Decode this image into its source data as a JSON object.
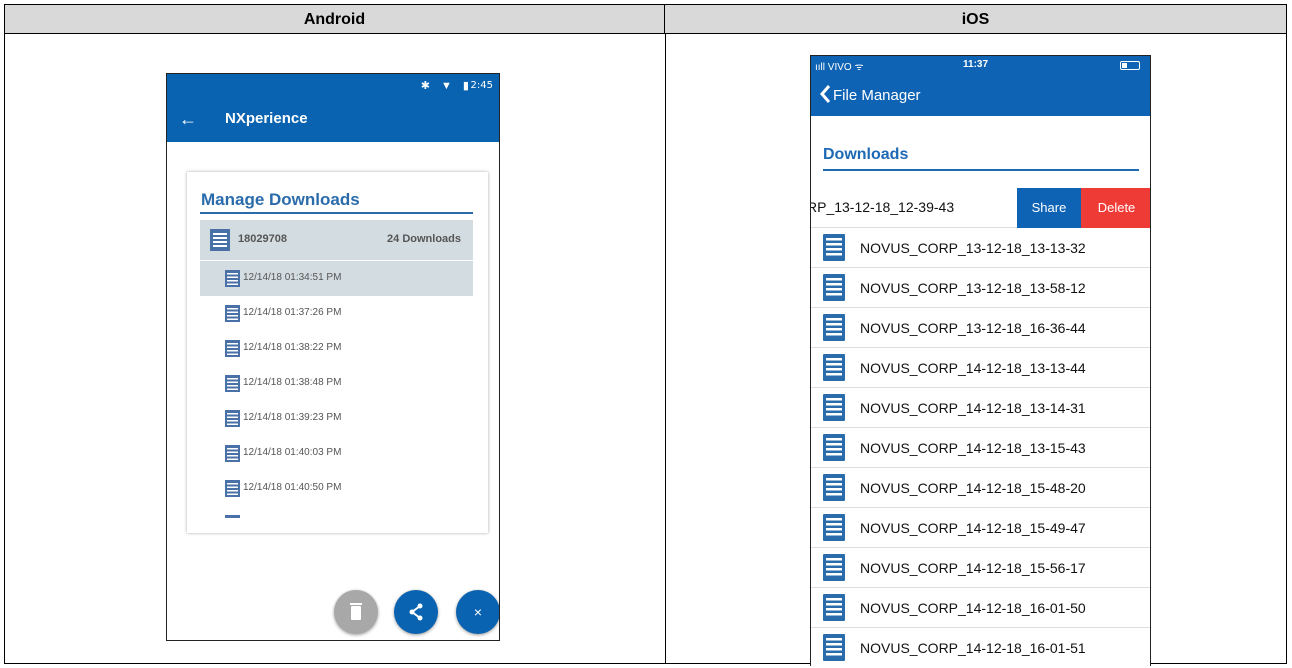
{
  "headers": {
    "android": "Android",
    "ios": "iOS"
  },
  "android": {
    "status": {
      "icons": "✱ ▼ ▮",
      "time": "2:45"
    },
    "appbar": {
      "back": "←",
      "title": "NXperience"
    },
    "card": {
      "title": "Manage Downloads",
      "group": {
        "name": "18029708",
        "count": "24 Downloads"
      },
      "items": [
        "12/14/18 01:34:51 PM",
        "12/14/18 01:37:26 PM",
        "12/14/18 01:38:22 PM",
        "12/14/18 01:38:48 PM",
        "12/14/18 01:39:23 PM",
        "12/14/18 01:40:03 PM",
        "12/14/18 01:40:50 PM"
      ],
      "selected_index": 0
    },
    "fab_close": "×",
    "colors": {
      "primary": "#0a63b0",
      "accent_text": "#2a6cab",
      "selected_bg": "#d3dde1",
      "delete_fab": "#a8a8a8"
    }
  },
  "ios": {
    "status": {
      "carrier": "ııll VIVO ᯤ",
      "time": "11:37"
    },
    "nav": {
      "back_label": "File Manager"
    },
    "title": "Downloads",
    "swiped_row": {
      "text": "RP_13-12-18_12-39-43",
      "share": "Share",
      "delete": "Delete"
    },
    "files": [
      "NOVUS_CORP_13-12-18_13-13-32",
      "NOVUS_CORP_13-12-18_13-58-12",
      "NOVUS_CORP_13-12-18_16-36-44",
      "NOVUS_CORP_14-12-18_13-13-44",
      "NOVUS_CORP_14-12-18_13-14-31",
      "NOVUS_CORP_14-12-18_13-15-43",
      "NOVUS_CORP_14-12-18_15-48-20",
      "NOVUS_CORP_14-12-18_15-49-47",
      "NOVUS_CORP_14-12-18_15-56-17",
      "NOVUS_CORP_14-12-18_16-01-50",
      "NOVUS_CORP_14-12-18_16-01-51"
    ],
    "colors": {
      "primary": "#0f63b4",
      "delete": "#ef3b36",
      "file_icon": "#2a6cab"
    }
  }
}
